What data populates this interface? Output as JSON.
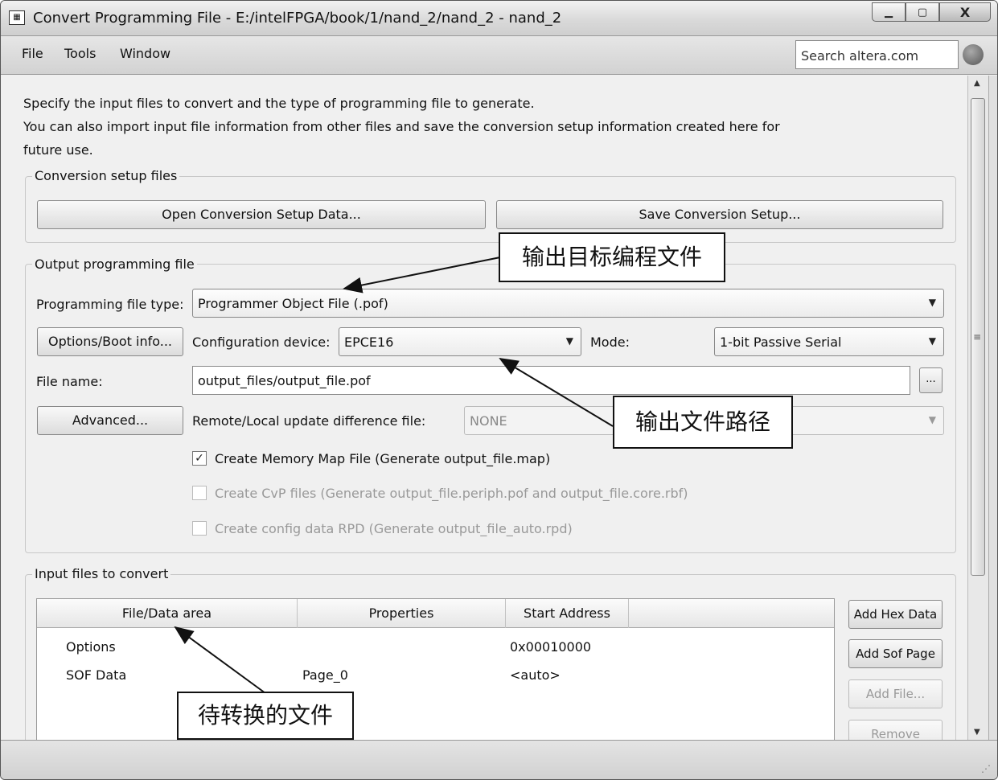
{
  "window": {
    "title": "Convert Programming File - E:/intelFPGA/book/1/nand_2/nand_2 - nand_2",
    "app_icon": "convert-app-icon",
    "minimize": "minimize-icon",
    "maximize": "maximize-icon",
    "close_label": "X"
  },
  "menubar": {
    "items": [
      "File",
      "Tools",
      "Window"
    ],
    "search_placeholder": "Search altera.com"
  },
  "description": {
    "line1": "Specify the input files to convert and the type of programming file to generate.",
    "line2": "You can also import input file information from other files and save the conversion setup information created here for",
    "line3": "future use."
  },
  "conversion_setup": {
    "title": "Conversion setup files",
    "open_button": "Open Conversion Setup Data...",
    "save_button": "Save Conversion Setup..."
  },
  "output": {
    "title": "Output programming file",
    "type_label": "Programming file type:",
    "type_value": "Programmer Object File (.pof)",
    "options_button": "Options/Boot info...",
    "config_label": "Configuration device:",
    "config_value": "EPCE16",
    "mode_label": "Mode:",
    "mode_value": "1-bit Passive Serial",
    "filename_label": "File name:",
    "filename_value": "output_files/output_file.pof",
    "browse_button": "...",
    "advanced_button": "Advanced...",
    "remote_label": "Remote/Local update difference file:",
    "remote_value": "NONE",
    "checkboxes": [
      {
        "label": "Create Memory Map File (Generate output_file.map)",
        "checked": true
      },
      {
        "label": "Create CvP files (Generate output_file.periph.pof and output_file.core.rbf)",
        "checked": false
      },
      {
        "label": "Create config data RPD (Generate output_file_auto.rpd)",
        "checked": false
      }
    ]
  },
  "input": {
    "title": "Input files to convert",
    "columns": [
      "File/Data area",
      "Properties",
      "Start Address"
    ],
    "rows": [
      {
        "file": "Options",
        "properties": "",
        "start": "0x00010000"
      },
      {
        "file": "SOF Data",
        "properties": "Page_0",
        "start": "<auto>"
      }
    ],
    "buttons": [
      "Add Hex Data",
      "Add Sof Page",
      "Add File...",
      "Remove"
    ]
  },
  "annotations": {
    "output_target": "输出目标编程文件",
    "output_path": "输出文件路径",
    "input_files": "待转换的文件"
  }
}
